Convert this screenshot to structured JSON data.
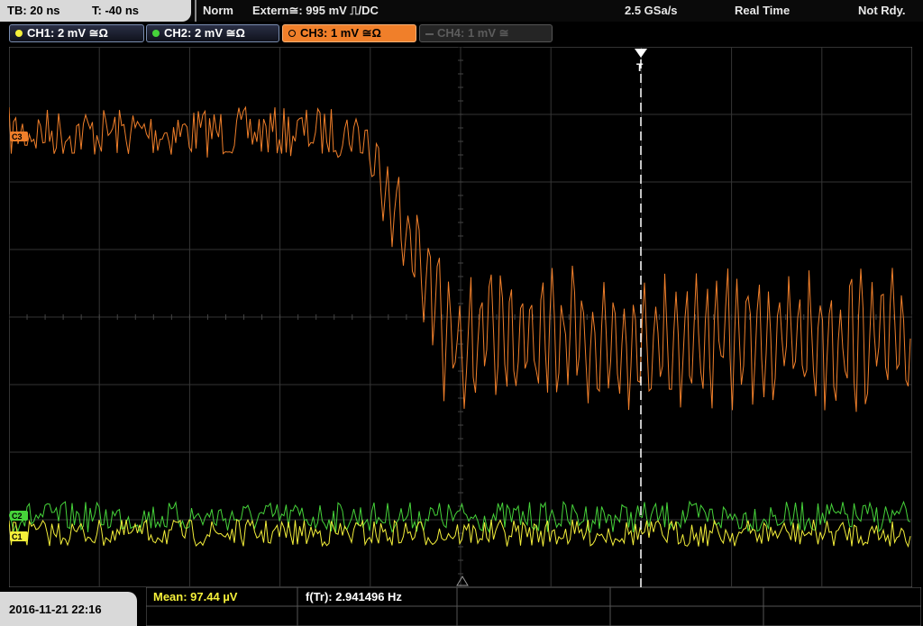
{
  "header": {
    "timebase": "TB: 20 ns",
    "trigger_time": "T: -40 ns",
    "trigger_mode": "Norm",
    "trigger_source": "Extern≅: 995 mV ⎍/DC",
    "sample_rate": "2.5 GSa/s",
    "acq_mode": "Real Time",
    "status": "Not Rdy."
  },
  "channels": [
    {
      "label": "CH1: 2 mV ≅Ω",
      "color": "#f5f03a",
      "state": "on"
    },
    {
      "label": "CH2: 2 mV ≅Ω",
      "color": "#46d33a",
      "state": "on"
    },
    {
      "label": "CH3: 1 mV ≅Ω",
      "color": "#f07f2a",
      "state": "active"
    },
    {
      "label": "CH4: 1 mV ≅",
      "color": "#888888",
      "state": "off"
    }
  ],
  "markers": {
    "ch3": "C3",
    "ch2": "C2",
    "ch1": "C1",
    "trigger": "T"
  },
  "footer": {
    "datetime": "2016-11-21 22:16",
    "mean": "Mean: 97.44 µV",
    "freq": "f(Tr): 2.941496 Hz"
  },
  "colors": {
    "ch1": "#f5f03a",
    "ch2": "#46d33a",
    "ch3": "#f07f2a",
    "grid": "#3a3a3a",
    "mean_text": "#f5f03a",
    "freq_text": "#ffffff"
  }
}
